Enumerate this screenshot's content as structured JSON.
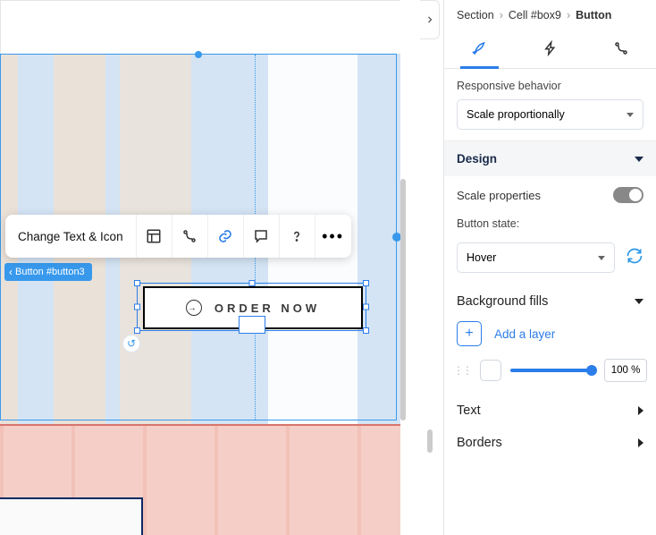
{
  "breadcrumb": {
    "a": "Section",
    "b": "Cell #box9",
    "c": "Button"
  },
  "tabs": {
    "design": "design",
    "anim": "animation",
    "link": "link"
  },
  "responsive": {
    "label": "Responsive behavior",
    "value": "Scale proportionally"
  },
  "design_header": "Design",
  "scale_props": {
    "label": "Scale properties"
  },
  "button_state": {
    "label": "Button state:",
    "value": "Hover"
  },
  "bg_fills": {
    "header": "Background fills",
    "add": "Add a layer",
    "opacity": "100 %"
  },
  "text_section": "Text",
  "borders_section": "Borders",
  "toolbar": {
    "change": "Change Text & Icon"
  },
  "selection_tag": "Button #button3",
  "order_button": {
    "label": "ORDER NOW"
  }
}
